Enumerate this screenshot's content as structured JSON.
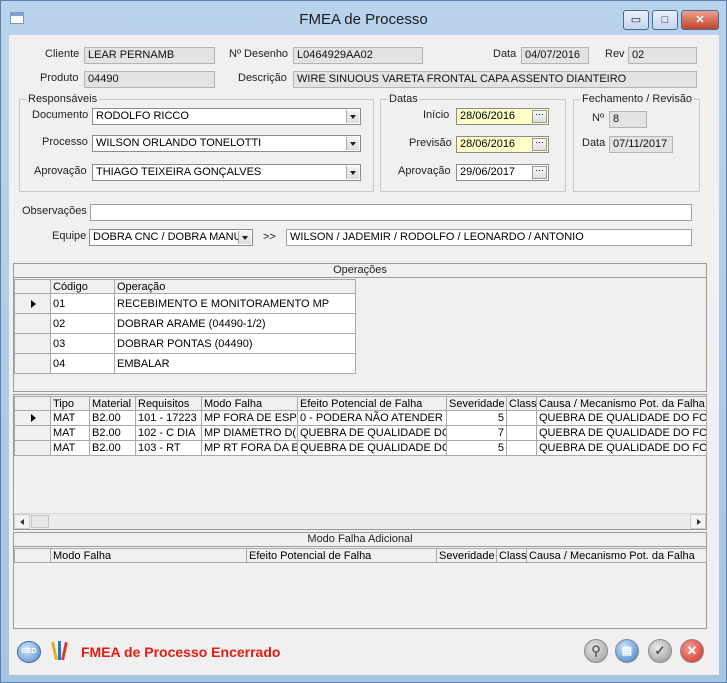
{
  "window": {
    "title": "FMEA de Processo",
    "controls": {
      "minimize": "▭",
      "maximize": "□",
      "close": "✕"
    }
  },
  "header": {
    "cliente_label": "Cliente",
    "cliente_value": "LEAR PERNAMB",
    "desenho_label": "Nº Desenho",
    "desenho_value": "L0464929AA02",
    "data_label": "Data",
    "data_value": "04/07/2016",
    "rev_label": "Rev",
    "rev_value": "02",
    "produto_label": "Produto",
    "produto_value": "04490",
    "descricao_label": "Descrição",
    "descricao_value": "WIRE SINUOUS VARETA FRONTAL CAPA ASSENTO DIANTEIRO"
  },
  "responsaveis": {
    "legend": "Responsáveis",
    "documento_label": "Documento",
    "documento_value": "RODOLFO RICCO",
    "processo_label": "Processo",
    "processo_value": "WILSON ORLANDO TONELOTTI",
    "aprovacao_label": "Aprovação",
    "aprovacao_value": "THIAGO TEIXEIRA GONÇALVES"
  },
  "datas": {
    "legend": "Datas",
    "inicio_label": "Início",
    "inicio_value": "28/06/2016",
    "previsao_label": "Previsão",
    "previsao_value": "28/06/2016",
    "aprovacao_label": "Aprovação",
    "aprovacao_value": "29/06/2017",
    "picker_label": "···"
  },
  "fechamento": {
    "legend": "Fechamento / Revisão",
    "num_label": "Nº",
    "num_value": "8",
    "data_label": "Data",
    "data_value": "07/11/2017"
  },
  "observacoes": {
    "label": "Observações",
    "value": ""
  },
  "equipe": {
    "label": "Equipe",
    "select_value": "DOBRA CNC / DOBRA MANU",
    "arrow_label": ">>",
    "members_value": "WILSON  / JADEMIR / RODOLFO / LEONARDO  / ANTONIO"
  },
  "operacoes": {
    "title": "Operações",
    "columns": [
      "Código",
      "Operação"
    ],
    "rows": [
      {
        "codigo": "01",
        "operacao": "RECEBIMENTO E MONITORAMENTO MP"
      },
      {
        "codigo": "02",
        "operacao": "DOBRAR ARAME (04490-1/2)"
      },
      {
        "codigo": "03",
        "operacao": "DOBRAR PONTAS (04490)"
      },
      {
        "codigo": "04",
        "operacao": "EMBALAR"
      }
    ]
  },
  "falhas": {
    "columns": [
      "Tipo",
      "Material",
      "Requisitos",
      "Modo Falha",
      "Efeito Potencial de Falha",
      "Severidade",
      "Class",
      "Causa / Mecanismo Pot. da Falha"
    ],
    "rows": [
      {
        "tipo": "MAT",
        "material": "B2.00",
        "requisitos": "101  -  17223",
        "modo": "MP FORA DE ESP",
        "efeito": "0 - PODERA NÃO ATENDER",
        "severidade": "5",
        "class": "",
        "causa": "QUEBRA DE QUALIDADE DO FOF"
      },
      {
        "tipo": "MAT",
        "material": "B2.00",
        "requisitos": "102  -  C DIA",
        "modo": "MP DIAMETRO D(",
        "efeito": "QUEBRA DE QUALIDADE DC",
        "severidade": "7",
        "class": "",
        "causa": "QUEBRA DE QUALIDADE DO FOF"
      },
      {
        "tipo": "MAT",
        "material": "B2.00",
        "requisitos": "103  -  RT",
        "modo": "MP RT FORA DA E",
        "efeito": "QUEBRA DE QUALIDADE DC",
        "severidade": "5",
        "class": "",
        "causa": "QUEBRA DE QUALIDADE DO FOF"
      }
    ]
  },
  "adicional": {
    "title": "Modo Falha Adicional",
    "columns": [
      "Modo Falha",
      "Efeito Potencial de Falha",
      "Severidade",
      "Class",
      "Causa / Mecanismo Pot. da Falha"
    ]
  },
  "footer": {
    "ged_label": "GED",
    "status_text": "FMEA de Processo Encerrado"
  },
  "colors": {
    "status": "#e31b12",
    "highlight_date": "#ffffc8",
    "close_red": "#d8281a",
    "ok_gray": "#8f8f8f"
  }
}
